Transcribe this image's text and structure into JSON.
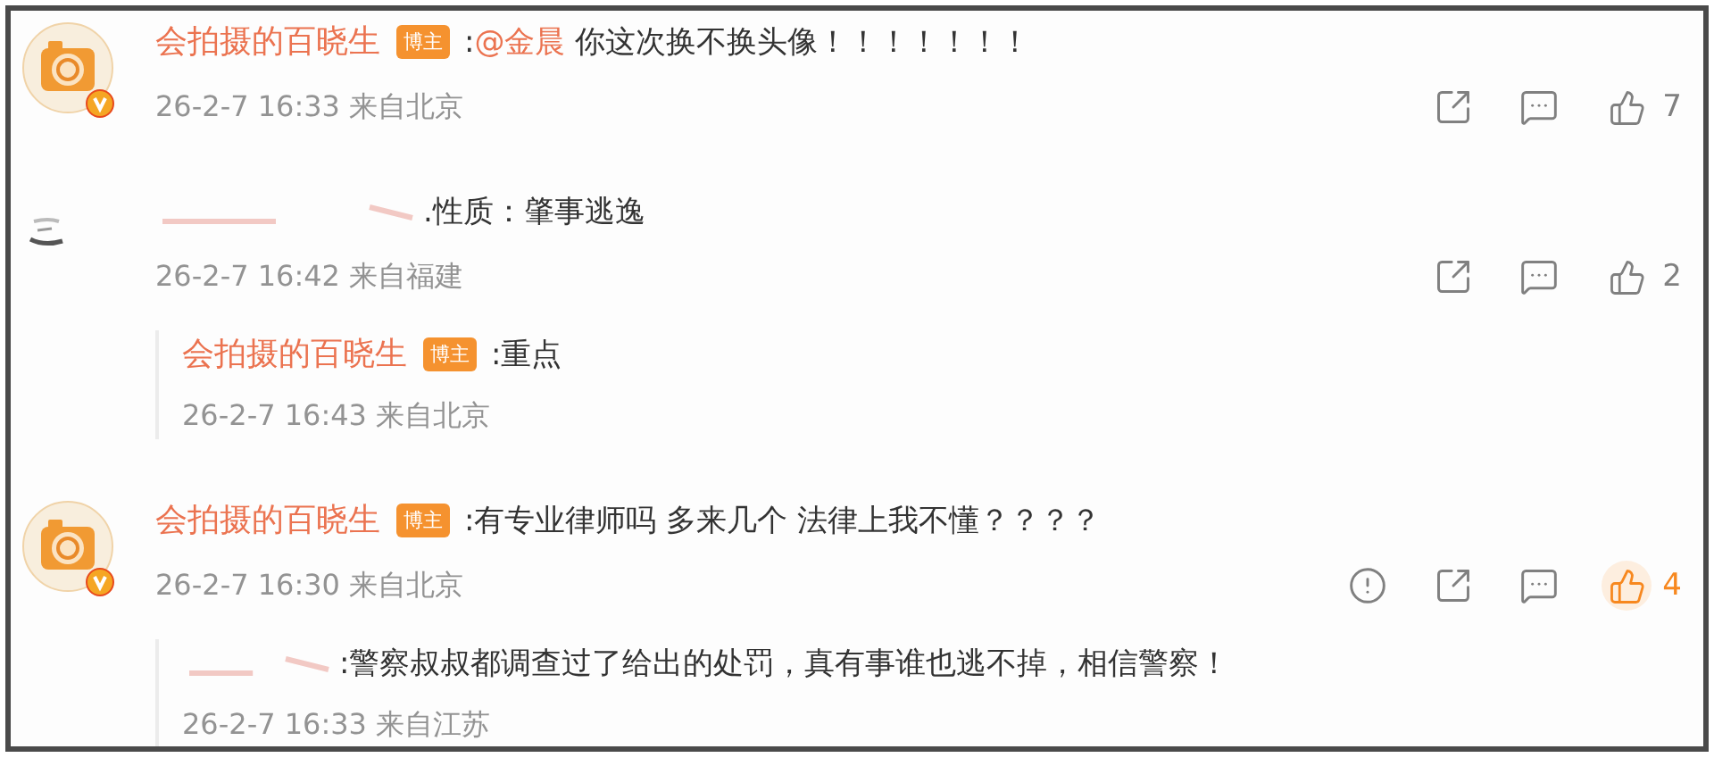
{
  "comments": [
    {
      "avatar": {
        "kind": "logo",
        "verified": true
      },
      "author_hidden": false,
      "author": "会拍摄的百晓生",
      "badge": "博主",
      "text": [
        {
          "text": ":"
        },
        {
          "text": "@金晨",
          "link": true
        },
        {
          "text": " 你这次换不换头像！！！！！！！"
        }
      ],
      "time": "26-2-7 16:33 来自北京",
      "report": false,
      "likes": "7",
      "liked": false
    },
    {
      "avatar": {
        "kind": "blurred",
        "verified": false
      },
      "author_hidden": true,
      "text": [
        {
          "text": ".性质：肇事逃逸"
        }
      ],
      "time": "26-2-7 16:42 来自福建",
      "report": false,
      "likes": "2",
      "liked": false,
      "replies": [
        {
          "author_hidden": false,
          "author": "会拍摄的百晓生",
          "badge": "博主",
          "text": ":重点",
          "time": "26-2-7 16:43 来自北京"
        }
      ]
    },
    {
      "avatar": {
        "kind": "logo",
        "verified": true
      },
      "author_hidden": false,
      "author": "会拍摄的百晓生",
      "badge": "博主",
      "text": [
        {
          "text": ":有专业律师吗 多来几个 法律上我不懂？？？？"
        }
      ],
      "time": "26-2-7 16:30 来自北京",
      "report": true,
      "likes": "4",
      "liked": true,
      "replies": [
        {
          "author_hidden": true,
          "text": ":警察叔叔都调查过了给出的处罚，真有事谁也逃不掉，相信警察！",
          "time": "26-2-7 16:33 来自江苏"
        }
      ]
    }
  ]
}
